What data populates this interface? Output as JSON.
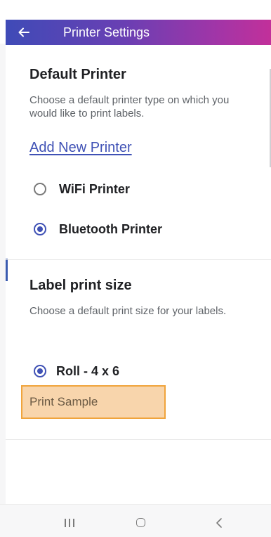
{
  "app_bar": {
    "title": "Printer Settings",
    "back_icon": "arrow-left-icon",
    "gradient_colors": [
      "#3f4bb7",
      "#a235a7",
      "#c2309a"
    ]
  },
  "default_printer": {
    "title": "Default Printer",
    "description": "Choose a default printer type on which you would like to print labels.",
    "add_link": "Add New Printer",
    "options": [
      {
        "label": "WiFi Printer",
        "selected": false
      },
      {
        "label": "Bluetooth Printer",
        "selected": true
      }
    ]
  },
  "label_size": {
    "title": "Label print size",
    "description": "Choose a default print size for your labels.",
    "options": [
      {
        "label": "Roll - 4 x 6",
        "selected": true
      }
    ],
    "print_sample_label": "Print Sample"
  },
  "nav_bar": {
    "recents_icon": "recents-icon",
    "home_icon": "home-icon",
    "back_icon": "back-chevron-icon"
  },
  "colors": {
    "accent": "#3f51b5",
    "highlight_fill": "#f8d5ac",
    "highlight_border": "#f0a43c"
  }
}
